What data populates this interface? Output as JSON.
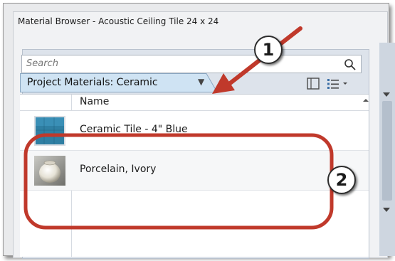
{
  "window": {
    "title": "Material Browser - Acoustic Ceiling Tile 24 x 24"
  },
  "search": {
    "placeholder": "Search"
  },
  "filter": {
    "label": "Project Materials: Ceramic"
  },
  "list": {
    "column_header": "Name",
    "items": [
      {
        "label": "Ceramic Tile - 4\" Blue",
        "thumbnail": "blue-tile-swatch"
      },
      {
        "label": "Porcelain, Ivory",
        "thumbnail": "ivory-porcelain-vase"
      }
    ]
  },
  "callouts": [
    {
      "number": "1"
    },
    {
      "number": "2"
    }
  ],
  "colors": {
    "callout_red": "#c0392b",
    "tile_blue": "#2f7fa3",
    "header_blue": "#cfe3f3"
  }
}
